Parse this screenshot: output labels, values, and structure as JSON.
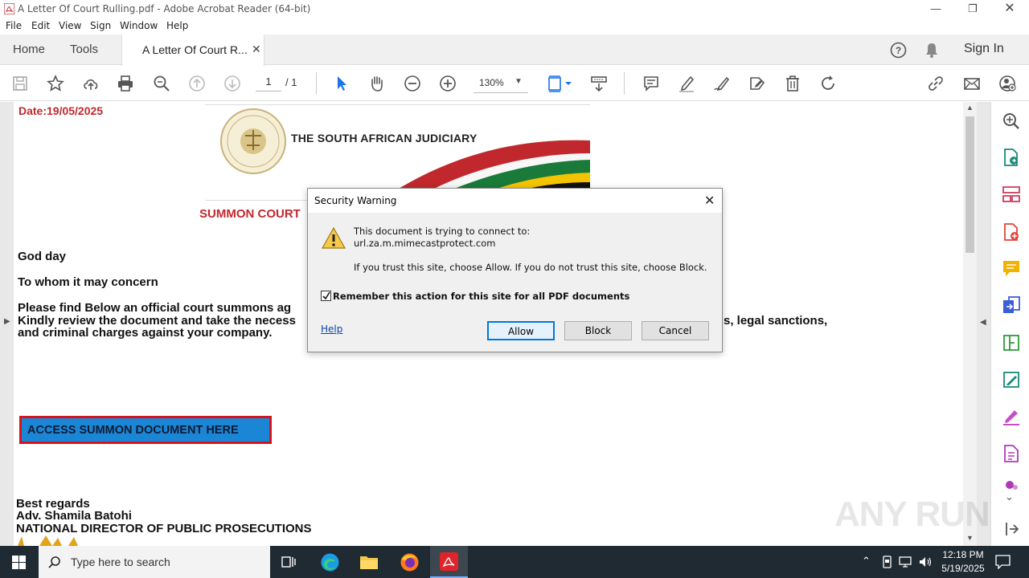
{
  "window": {
    "title": "A Letter Of Court Rulling.pdf - Adobe Acrobat Reader (64-bit)"
  },
  "menu": [
    "File",
    "Edit",
    "View",
    "Sign",
    "Window",
    "Help"
  ],
  "tabs": {
    "home": "Home",
    "tools": "Tools",
    "doc": "A Letter Of Court R...",
    "signin": "Sign In"
  },
  "toolbar": {
    "page_current": "1",
    "page_total": "/ 1",
    "zoom": "130%"
  },
  "document": {
    "date": "Date:19/05/2025",
    "org": "THE SOUTH AFRICAN JUDICIARY",
    "summon_heading": "SUMMON COURT",
    "greeting": "God day",
    "to_whom": "To whom it may concern",
    "line1": "Please find Below an official court summons ag",
    "line2": "Kindly review the document and take the necess",
    "line2_tail": "s, legal sanctions,",
    "line3": "and criminal charges against your company.",
    "access_button": "ACCESS SUMMON DOCUMENT HERE",
    "regards": "Best regards",
    "signer": "Adv. Shamila Batohi",
    "signer_title": "NATIONAL DIRECTOR OF PUBLIC PROSECUTIONS"
  },
  "dialog": {
    "title": "Security Warning",
    "line1": "This document is trying to connect to:",
    "url": "url.za.m.mimecastprotect.com",
    "line2": "If you trust this site, choose Allow. If you do not trust this site, choose Block.",
    "checkbox_label": "Remember this action for this site for all PDF documents",
    "checkbox_checked": true,
    "help": "Help",
    "allow": "Allow",
    "block": "Block",
    "cancel": "Cancel"
  },
  "taskbar": {
    "search_placeholder": "Type here to search",
    "time": "12:18 PM",
    "date": "5/19/2025"
  },
  "watermark": "ANY RUN",
  "colors": {
    "accent_red": "#c0282d",
    "link_blue": "#0645ad",
    "access_bg": "#1b86d6",
    "taskbar": "#1f2a33"
  }
}
